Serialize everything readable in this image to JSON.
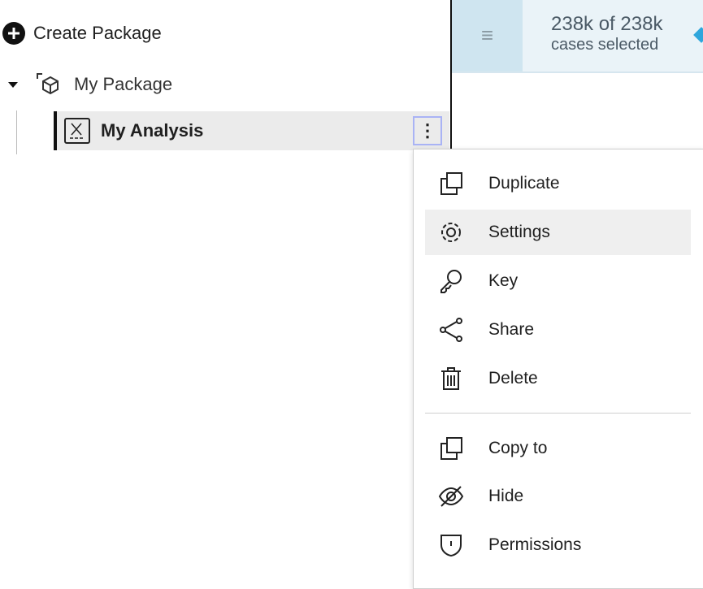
{
  "sidebar": {
    "create_label": "Create Package",
    "package_label": "My Package",
    "analysis_label": "My Analysis"
  },
  "topbar": {
    "count": "238k of 238k",
    "subtitle": "cases selected"
  },
  "menu": {
    "items": [
      {
        "label": "Duplicate",
        "icon": "duplicate-icon"
      },
      {
        "label": "Settings",
        "icon": "gear-icon"
      },
      {
        "label": "Key",
        "icon": "key-icon"
      },
      {
        "label": "Share",
        "icon": "share-icon"
      },
      {
        "label": "Delete",
        "icon": "trash-icon"
      },
      {
        "label": "Copy to",
        "icon": "copy-icon"
      },
      {
        "label": "Hide",
        "icon": "eye-off-icon"
      },
      {
        "label": "Permissions",
        "icon": "shield-icon"
      }
    ]
  }
}
